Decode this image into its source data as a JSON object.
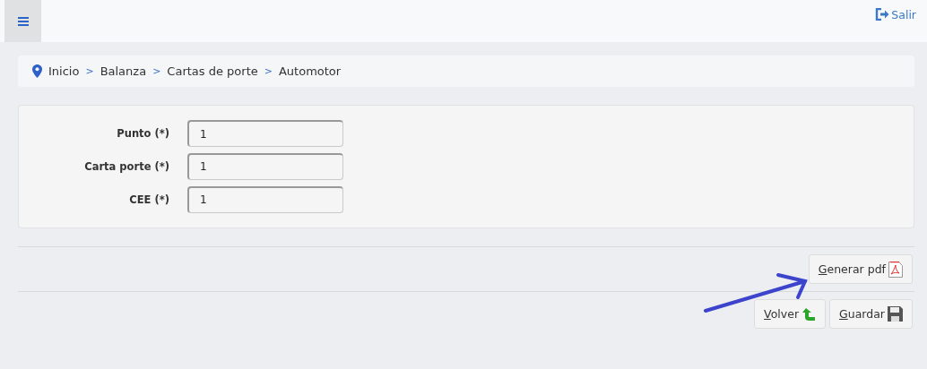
{
  "topbar": {
    "logout": "Salir"
  },
  "breadcrumb": [
    "Inicio",
    "Balanza",
    "Cartas de porte",
    "Automotor"
  ],
  "breadcrumb_separator": ">",
  "fields": [
    {
      "label": "Punto (*)",
      "value": "1"
    },
    {
      "label": "Carta porte (*)",
      "value": "1"
    },
    {
      "label": "CEE (*)",
      "value": "1"
    }
  ],
  "pdf_button": {
    "label": "Generar pdf"
  },
  "buttons": [
    {
      "label": "Volver",
      "kind": "back"
    },
    {
      "label": "Guardar",
      "kind": "save"
    }
  ],
  "annotation": {
    "kind": "arrow"
  }
}
